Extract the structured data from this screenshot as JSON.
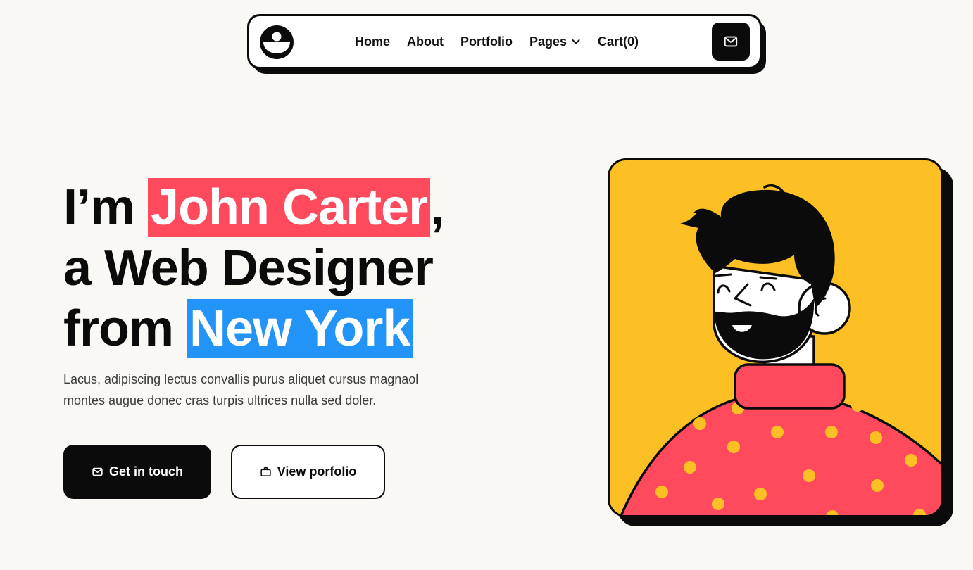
{
  "colors": {
    "accent_red": "#ff4a5e",
    "accent_blue": "#2394f7",
    "card_yellow": "#fdc024",
    "ink": "#0b0b0b",
    "background": "#f9f8f5"
  },
  "nav": {
    "logo_icon": "smiling-face-logo",
    "links": [
      "Home",
      "About",
      "Portfolio",
      "Pages",
      "Cart(0)"
    ],
    "pages_icon": "chevron-down-icon",
    "mail_icon": "mail-icon"
  },
  "hero": {
    "line1_prefix": "I’m ",
    "name": "John Carter",
    "line1_suffix": ",",
    "line2": "a Web Designer",
    "line3_prefix": "from ",
    "city": "New York",
    "description_line1": "Lacus, adipiscing lectus convallis purus aliquet cursus magnaol",
    "description_line2": "montes augue donec cras turpis ultrices nulla sed doler.",
    "primary_button": "Get in touch",
    "primary_button_icon": "mail-icon",
    "secondary_button": "View porfolio",
    "secondary_button_icon": "briefcase-icon"
  },
  "illustration": {
    "subject": "bearded-man-in-polka-dot-sweater-illustration"
  }
}
